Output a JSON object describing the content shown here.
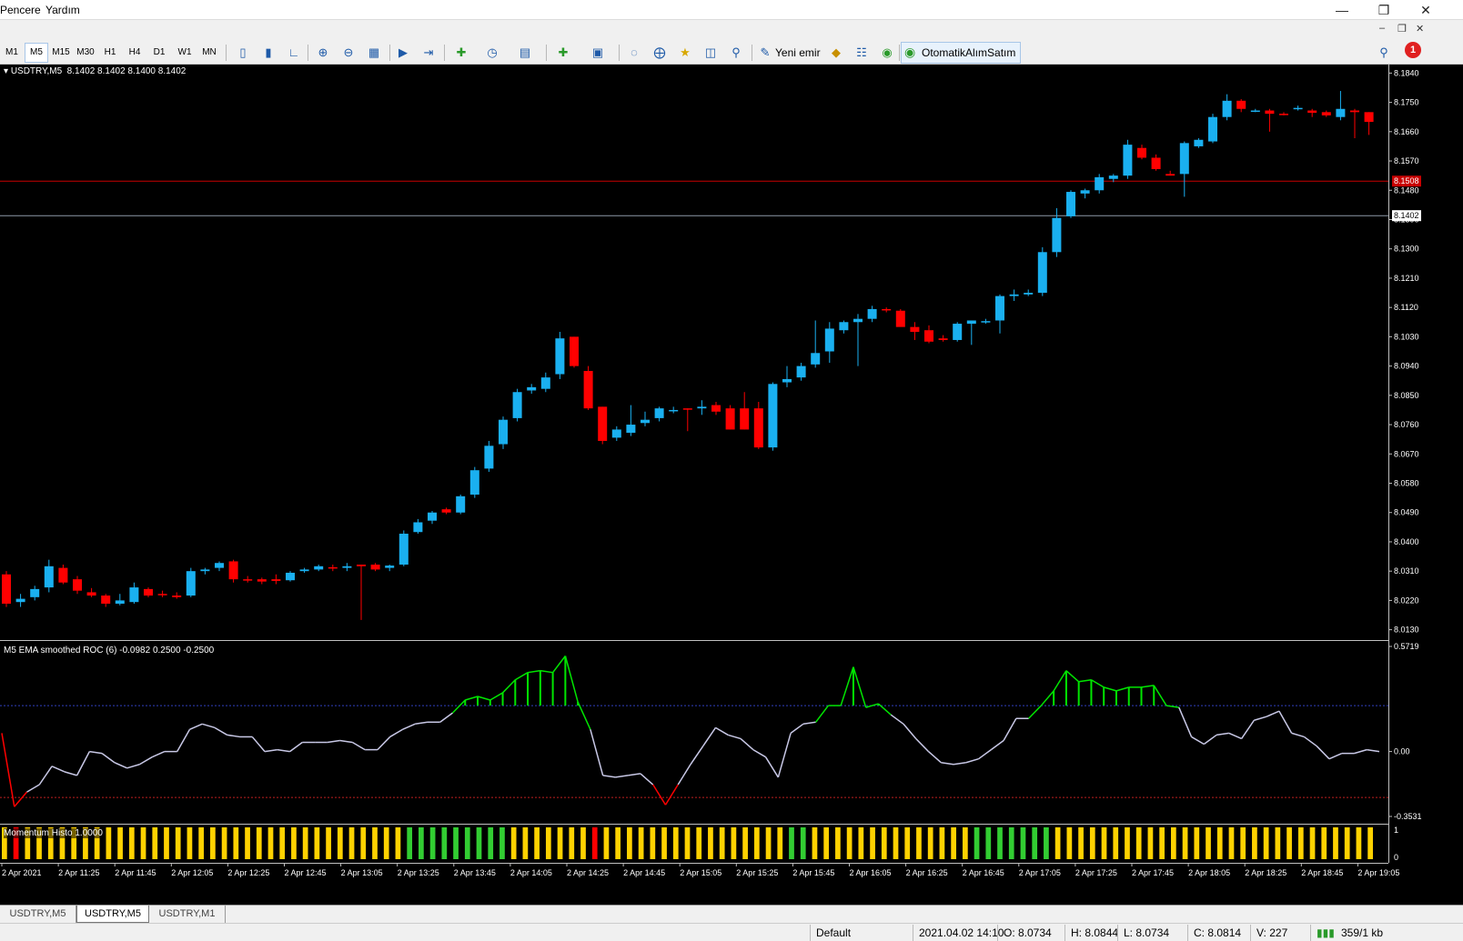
{
  "menu": {
    "window": "Pencere",
    "help": "Yardım"
  },
  "toolbar": {
    "timeframes": [
      "M1",
      "M5",
      "M15",
      "M30",
      "H1",
      "H4",
      "D1",
      "W1",
      "MN"
    ],
    "active_timeframe": "M5",
    "new_order_label": "Yeni emir",
    "autotrading_label": "OtomatikAlımSatım",
    "notification_count": "1"
  },
  "chart": {
    "header": "USDTRY,M5  8.1402 8.1402 8.1400 8.1402",
    "bid_label": "8.1402",
    "ask_label": "8.1508",
    "indicator_label": "M5 EMA smoothed ROC (6) -0.0982 0.2500 -0.2500",
    "histo_label": "Momentum Histo 1.0000",
    "histo_max": "1",
    "histo_min": "0",
    "colors": {
      "bull": "#1ab0f0",
      "bear": "#ff0000",
      "roc_line": "#c8c8e6",
      "roc_up": "#00e600",
      "roc_down": "#ff0000",
      "hist_default": "#ffd200",
      "hist_up": "#32cd32",
      "hist_down": "#ff0000"
    }
  },
  "chart_data": [
    {
      "type": "candlestick",
      "symbol": "USDTRY",
      "timeframe": "M5",
      "y_ticks": [
        "8.1840",
        "8.1750",
        "8.1660",
        "8.1570",
        "8.1480",
        "8.1390",
        "8.1300",
        "8.1210",
        "8.1120",
        "8.1030",
        "8.0940",
        "8.0850",
        "8.0760",
        "8.0670",
        "8.0580",
        "8.0490",
        "8.0400",
        "8.0310",
        "8.0220",
        "8.0130"
      ],
      "ylim": [
        8.0115,
        8.1855
      ],
      "x_labels": [
        "2 Apr 2021",
        "2 Apr 11:25",
        "2 Apr 11:45",
        "2 Apr 12:05",
        "2 Apr 12:25",
        "2 Apr 12:45",
        "2 Apr 13:05",
        "2 Apr 13:25",
        "2 Apr 13:45",
        "2 Apr 14:05",
        "2 Apr 14:25",
        "2 Apr 14:45",
        "2 Apr 15:05",
        "2 Apr 15:25",
        "2 Apr 15:45",
        "2 Apr 16:05",
        "2 Apr 16:25",
        "2 Apr 16:45",
        "2 Apr 17:05",
        "2 Apr 17:25",
        "2 Apr 17:45",
        "2 Apr 18:05",
        "2 Apr 18:25",
        "2 Apr 18:45",
        "2 Apr 19:05"
      ],
      "horizontal_lines": [
        8.1508,
        8.1402
      ],
      "candles": [
        [
          8.03,
          8.031,
          8.02,
          8.021
        ],
        [
          8.0215,
          8.024,
          8.02,
          8.0225
        ],
        [
          8.023,
          8.0265,
          8.022,
          8.0255
        ],
        [
          8.026,
          8.0345,
          8.0245,
          8.0325
        ],
        [
          8.032,
          8.033,
          8.027,
          8.0275
        ],
        [
          8.0285,
          8.0295,
          8.024,
          8.025
        ],
        [
          8.0245,
          8.0258,
          8.023,
          8.0235
        ],
        [
          8.0235,
          8.024,
          8.02,
          8.021
        ],
        [
          8.021,
          8.024,
          8.0205,
          8.022
        ],
        [
          8.0215,
          8.0275,
          8.021,
          8.026
        ],
        [
          8.0255,
          8.026,
          8.023,
          8.0235
        ],
        [
          8.024,
          8.025,
          8.023,
          8.0238
        ],
        [
          8.0235,
          8.0245,
          8.0225,
          8.023
        ],
        [
          8.0235,
          8.032,
          8.023,
          8.031
        ],
        [
          8.031,
          8.032,
          8.03,
          8.0315
        ],
        [
          8.032,
          8.034,
          8.031,
          8.0335
        ],
        [
          8.034,
          8.0345,
          8.0275,
          8.0285
        ],
        [
          8.0285,
          8.0295,
          8.0275,
          8.0282
        ],
        [
          8.0285,
          8.029,
          8.027,
          8.0278
        ],
        [
          8.0285,
          8.03,
          8.027,
          8.028
        ],
        [
          8.0282,
          8.031,
          8.0278,
          8.0305
        ],
        [
          8.031,
          8.032,
          8.0305,
          8.0315
        ],
        [
          8.0315,
          8.033,
          8.031,
          8.0325
        ],
        [
          8.0322,
          8.033,
          8.031,
          8.032
        ],
        [
          8.032,
          8.0335,
          8.031,
          8.0325
        ],
        [
          8.033,
          8.033,
          8.016,
          8.0325
        ],
        [
          8.033,
          8.0335,
          8.031,
          8.0315
        ],
        [
          8.032,
          8.033,
          8.031,
          8.0327
        ],
        [
          8.033,
          8.0435,
          8.0325,
          8.0425
        ],
        [
          8.043,
          8.047,
          8.0425,
          8.046
        ],
        [
          8.0465,
          8.0495,
          8.0455,
          8.049
        ],
        [
          8.05,
          8.0505,
          8.0485,
          8.049
        ],
        [
          8.049,
          8.0545,
          8.0485,
          8.054
        ],
        [
          8.0545,
          8.063,
          8.0535,
          8.062
        ],
        [
          8.0625,
          8.071,
          8.0615,
          8.0695
        ],
        [
          8.07,
          8.0785,
          8.0685,
          8.0775
        ],
        [
          8.078,
          8.087,
          8.077,
          8.086
        ],
        [
          8.0865,
          8.0885,
          8.0855,
          8.0875
        ],
        [
          8.087,
          8.092,
          8.086,
          8.0905
        ],
        [
          8.0915,
          8.1045,
          8.09,
          8.1025
        ],
        [
          8.103,
          8.103,
          8.0935,
          8.094
        ],
        [
          8.0925,
          8.094,
          8.0805,
          8.081
        ],
        [
          8.0815,
          8.0815,
          8.07,
          8.071
        ],
        [
          8.072,
          8.0755,
          8.071,
          8.0745
        ],
        [
          8.0735,
          8.082,
          8.0725,
          8.076
        ],
        [
          8.0765,
          8.08,
          8.0755,
          8.0775
        ],
        [
          8.078,
          8.0815,
          8.077,
          8.081
        ],
        [
          8.0805,
          8.0815,
          8.0795,
          8.0805
        ],
        [
          8.081,
          8.081,
          8.074,
          8.0808
        ],
        [
          8.081,
          8.0835,
          8.079,
          8.0815
        ],
        [
          8.082,
          8.083,
          8.079,
          8.08
        ],
        [
          8.081,
          8.082,
          8.0745,
          8.0745
        ],
        [
          8.081,
          8.086,
          8.0745,
          8.0745
        ],
        [
          8.081,
          8.083,
          8.0685,
          8.069
        ],
        [
          8.069,
          8.089,
          8.068,
          8.0885
        ],
        [
          8.089,
          8.094,
          8.0875,
          8.09
        ],
        [
          8.0905,
          8.095,
          8.0895,
          8.094
        ],
        [
          8.0945,
          8.108,
          8.0935,
          8.098
        ],
        [
          8.0985,
          8.1075,
          8.095,
          8.1055
        ],
        [
          8.105,
          8.108,
          8.104,
          8.1075
        ],
        [
          8.1075,
          8.11,
          8.094,
          8.1085
        ],
        [
          8.1085,
          8.1125,
          8.1075,
          8.1115
        ],
        [
          8.1115,
          8.112,
          8.1105,
          8.1112
        ],
        [
          8.111,
          8.1115,
          8.107,
          8.106
        ],
        [
          8.106,
          8.1075,
          8.102,
          8.1045
        ],
        [
          8.105,
          8.1065,
          8.101,
          8.1015
        ],
        [
          8.1025,
          8.1035,
          8.1015,
          8.102
        ],
        [
          8.102,
          8.1075,
          8.1015,
          8.107
        ],
        [
          8.107,
          8.108,
          8.1005,
          8.108
        ],
        [
          8.1075,
          8.1085,
          8.107,
          8.1078
        ],
        [
          8.108,
          8.116,
          8.104,
          8.1155
        ],
        [
          8.1155,
          8.1175,
          8.114,
          8.116
        ],
        [
          8.116,
          8.1175,
          8.1155,
          8.1165
        ],
        [
          8.1165,
          8.1305,
          8.1155,
          8.129
        ],
        [
          8.129,
          8.1425,
          8.1275,
          8.1395
        ],
        [
          8.14,
          8.148,
          8.1395,
          8.1475
        ],
        [
          8.147,
          8.1485,
          8.1455,
          8.148
        ],
        [
          8.148,
          8.153,
          8.147,
          8.152
        ],
        [
          8.1515,
          8.153,
          8.1505,
          8.1525
        ],
        [
          8.1525,
          8.1635,
          8.1515,
          8.162
        ],
        [
          8.161,
          8.162,
          8.1575,
          8.158
        ],
        [
          8.158,
          8.159,
          8.154,
          8.1545
        ],
        [
          8.153,
          8.154,
          8.1525,
          8.1525
        ],
        [
          8.153,
          8.163,
          8.146,
          8.1625
        ],
        [
          8.1615,
          8.164,
          8.161,
          8.1635
        ],
        [
          8.163,
          8.1715,
          8.1625,
          8.1705
        ],
        [
          8.1705,
          8.1775,
          8.1695,
          8.1755
        ],
        [
          8.1755,
          8.176,
          8.172,
          8.173
        ],
        [
          8.1725,
          8.173,
          8.172,
          8.1725
        ],
        [
          8.1725,
          8.173,
          8.166,
          8.1715
        ],
        [
          8.1715,
          8.172,
          8.171,
          8.1712
        ],
        [
          8.173,
          8.174,
          8.1725,
          8.1733
        ],
        [
          8.1725,
          8.173,
          8.1705,
          8.1718
        ],
        [
          8.172,
          8.1725,
          8.1705,
          8.171
        ],
        [
          8.1705,
          8.1785,
          8.1695,
          8.173
        ],
        [
          8.1725,
          8.173,
          8.164,
          8.172
        ],
        [
          8.172,
          8.172,
          8.165,
          8.169
        ]
      ]
    },
    {
      "type": "line",
      "name": "M5 EMA smoothed ROC (6)",
      "y_ticks": [
        "0.5719",
        "0.00",
        "-0.3531"
      ],
      "ylim": [
        -0.3531,
        0.5719
      ],
      "levels": [
        0.25,
        -0.25
      ],
      "values": [
        0.1,
        -0.3,
        -0.22,
        -0.18,
        -0.08,
        -0.11,
        -0.13,
        0.0,
        -0.01,
        -0.06,
        -0.09,
        -0.07,
        -0.03,
        0.0,
        0.0,
        0.12,
        0.15,
        0.13,
        0.09,
        0.08,
        0.08,
        0.0,
        0.01,
        0.0,
        0.05,
        0.05,
        0.05,
        0.06,
        0.05,
        0.01,
        0.01,
        0.08,
        0.12,
        0.15,
        0.16,
        0.16,
        0.21,
        0.28,
        0.3,
        0.28,
        0.32,
        0.39,
        0.43,
        0.44,
        0.43,
        0.52,
        0.27,
        0.12,
        -0.13,
        -0.14,
        -0.13,
        -0.12,
        -0.18,
        -0.29,
        -0.18,
        -0.07,
        0.03,
        0.13,
        0.09,
        0.07,
        0.01,
        -0.03,
        -0.14,
        0.1,
        0.15,
        0.16,
        0.25,
        0.25,
        0.46,
        0.24,
        0.26,
        0.2,
        0.15,
        0.07,
        0.0,
        -0.06,
        -0.07,
        -0.06,
        -0.04,
        0.01,
        0.06,
        0.18,
        0.18,
        0.25,
        0.33,
        0.44,
        0.38,
        0.39,
        0.35,
        0.33,
        0.35,
        0.35,
        0.36,
        0.25,
        0.24,
        0.08,
        0.04,
        0.09,
        0.1,
        0.07,
        0.17,
        0.19,
        0.22,
        0.1,
        0.08,
        0.03,
        -0.04,
        -0.01,
        -0.01,
        0.01,
        0.0
      ],
      "hist_signal": [
        0,
        -1,
        0,
        0,
        0,
        0,
        0,
        0,
        0,
        0,
        0,
        0,
        0,
        0,
        0,
        0,
        0,
        0,
        0,
        0,
        0,
        0,
        0,
        0,
        0,
        0,
        0,
        0,
        0,
        0,
        0,
        0,
        0,
        0,
        0,
        1,
        1,
        1,
        1,
        1,
        1,
        1,
        1,
        1,
        0,
        0,
        0,
        0,
        0,
        0,
        0,
        -1,
        0,
        0,
        0,
        0,
        0,
        0,
        0,
        0,
        0,
        0,
        0,
        0,
        0,
        0,
        0,
        0,
        1,
        1,
        0,
        0,
        0,
        0,
        0,
        0,
        0,
        0,
        0,
        0,
        0,
        0,
        0,
        0,
        1,
        1,
        1,
        1,
        1,
        1,
        1,
        0,
        0,
        0,
        0,
        0,
        0,
        0,
        0,
        0,
        0,
        0,
        0,
        0,
        0,
        0,
        0,
        0,
        0,
        0,
        0,
        0,
        0,
        0,
        0,
        0,
        0,
        0,
        0
      ]
    }
  ],
  "tabs": [
    "USDTRY,M5",
    "USDTRY,M5",
    "USDTRY,M1"
  ],
  "active_tab": 1,
  "status": {
    "profile": "Default",
    "datetime": "2021.04.02 14:10",
    "open": "O: 8.0734",
    "high": "H: 8.0844",
    "low": "L: 8.0734",
    "close": "C: 8.0814",
    "volume": "V: 227",
    "traffic": "359/1 kb"
  }
}
